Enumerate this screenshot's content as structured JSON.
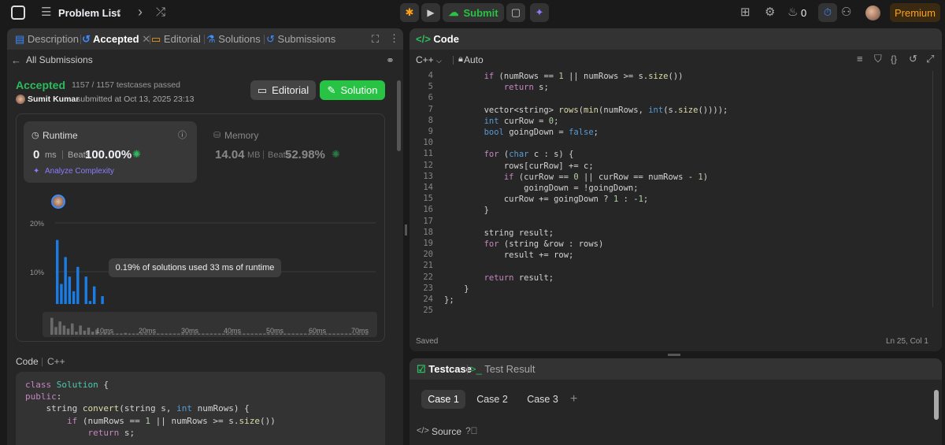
{
  "topbar": {
    "problem_list": "Problem List",
    "submit": "Submit",
    "streak": "0",
    "premium": "Premium"
  },
  "left": {
    "tabs": {
      "description": "Description",
      "accepted": "Accepted",
      "editorial": "Editorial",
      "solutions": "Solutions",
      "submissions": "Submissions"
    },
    "back": "All Submissions",
    "status": "Accepted",
    "testcases": "1157 / 1157 testcases passed",
    "user": "Sumit Kumar",
    "submitted": "submitted at Oct 13, 2025 23:13",
    "editorial_btn": "Editorial",
    "solution_btn": "Solution",
    "runtime": {
      "label": "Runtime",
      "value": "0",
      "unit": "ms",
      "beats_label": "Beats",
      "beats": "100.00%"
    },
    "memory": {
      "label": "Memory",
      "value": "14.04",
      "unit": "MB",
      "beats_label": "Beats",
      "beats": "52.98%"
    },
    "analyze": "Analyze Complexity",
    "tooltip": "0.19% of solutions used 33 ms of runtime",
    "code_label": "Code",
    "lang_label": "C++",
    "code_lines": [
      "class Solution {",
      "public:",
      "    string convert(string s, int numRows) {",
      "        if (numRows == 1 || numRows >= s.size())",
      "            return s;"
    ]
  },
  "chart_data": {
    "type": "bar",
    "yticks": [
      "20%",
      "10%",
      "0%"
    ],
    "xticks": [
      "10ms",
      "20ms",
      "30ms",
      "40ms",
      "50ms",
      "60ms",
      "70ms"
    ],
    "ylim": [
      0,
      20
    ],
    "xlim": [
      0,
      75
    ],
    "values": [
      16.5,
      7.5,
      13,
      9,
      6,
      11,
      3,
      9,
      4,
      7,
      3,
      5,
      1,
      2,
      1.5,
      0.8,
      0.6,
      0.6,
      1.8,
      0.6,
      0.9,
      0.5,
      0.6,
      0.4,
      0.8,
      0.4,
      0.5,
      0.4,
      0.6,
      0.4,
      0.5,
      0.4,
      0.6,
      0.4,
      0.5,
      0.4,
      0.6,
      0.4,
      0.5,
      0.4,
      0.6,
      0.4,
      0.5,
      0.4,
      0.6,
      0.4,
      0.5,
      0.4,
      0.6,
      0.4,
      0.5,
      0.4,
      0.6,
      0.4,
      0.5,
      0.4,
      0.6,
      0.4,
      0.5,
      0.4,
      0.6,
      0.4,
      0.5,
      0.4,
      0.6,
      0.4,
      0.5,
      0.4,
      0.6,
      0.4,
      0.5,
      0.4,
      0.6,
      0.4,
      0.5,
      0.4,
      0.6,
      0.4
    ]
  },
  "editor": {
    "title": "Code",
    "lang": "C++",
    "auto": "Auto",
    "saved": "Saved",
    "cursor": "Ln 25, Col 1",
    "lines": [
      {
        "n": "4",
        "t": "        if (numRows == 1 || numRows >= s.size())"
      },
      {
        "n": "5",
        "t": "            return s;"
      },
      {
        "n": "6",
        "t": ""
      },
      {
        "n": "7",
        "t": "        vector<string> rows(min(numRows, int(s.size())));"
      },
      {
        "n": "8",
        "t": "        int curRow = 0;"
      },
      {
        "n": "9",
        "t": "        bool goingDown = false;"
      },
      {
        "n": "10",
        "t": ""
      },
      {
        "n": "11",
        "t": "        for (char c : s) {"
      },
      {
        "n": "12",
        "t": "            rows[curRow] += c;"
      },
      {
        "n": "13",
        "t": "            if (curRow == 0 || curRow == numRows - 1)"
      },
      {
        "n": "14",
        "t": "                goingDown = !goingDown;"
      },
      {
        "n": "15",
        "t": "            curRow += goingDown ? 1 : -1;"
      },
      {
        "n": "16",
        "t": "        }"
      },
      {
        "n": "17",
        "t": ""
      },
      {
        "n": "18",
        "t": "        string result;"
      },
      {
        "n": "19",
        "t": "        for (string &row : rows)"
      },
      {
        "n": "20",
        "t": "            result += row;"
      },
      {
        "n": "21",
        "t": ""
      },
      {
        "n": "22",
        "t": "        return result;"
      },
      {
        "n": "23",
        "t": "    }"
      },
      {
        "n": "24",
        "t": "};"
      },
      {
        "n": "25",
        "t": ""
      }
    ]
  },
  "testpanel": {
    "testcase": "Testcase",
    "result": "Test Result",
    "cases": [
      "Case 1",
      "Case 2",
      "Case 3"
    ],
    "source": "Source"
  },
  "colors": {
    "accent_green": "#2cbb5d",
    "submit_green": "#28c244",
    "bar_blue": "#1a7ce6",
    "premium_orange": "#ffa116"
  }
}
